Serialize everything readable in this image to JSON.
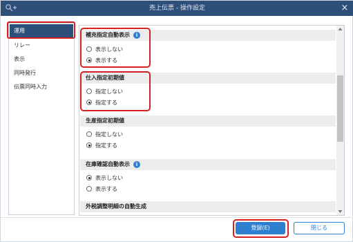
{
  "window": {
    "title": "売上伝票 - 操作設定",
    "close_glyph": "×",
    "icons": {
      "app": "app-key-plus-icon",
      "close": "close-icon",
      "info": "info-icon"
    }
  },
  "sidebar": {
    "items": [
      {
        "label": "運用",
        "active": true
      },
      {
        "label": "リレー",
        "active": false
      },
      {
        "label": "表示",
        "active": false
      },
      {
        "label": "同時発行",
        "active": false
      },
      {
        "label": "伝票同時入力",
        "active": false
      }
    ]
  },
  "sections": [
    {
      "title": "補充指定自動表示",
      "has_info": true,
      "options": [
        {
          "label": "表示しない",
          "checked": false
        },
        {
          "label": "表示する",
          "checked": true
        }
      ]
    },
    {
      "title": "仕入指定初期値",
      "has_info": false,
      "options": [
        {
          "label": "指定しない",
          "checked": false
        },
        {
          "label": "指定する",
          "checked": true
        }
      ]
    },
    {
      "title": "生産指定初期値",
      "has_info": false,
      "options": [
        {
          "label": "指定しない",
          "checked": false
        },
        {
          "label": "指定する",
          "checked": true
        }
      ]
    },
    {
      "title": "在庫確認自動表示",
      "has_info": true,
      "options": [
        {
          "label": "表示しない",
          "checked": true
        },
        {
          "label": "表示する",
          "checked": false
        }
      ]
    },
    {
      "title": "外税調整明細の自動生成",
      "has_info": false,
      "options": []
    }
  ],
  "footer": {
    "register_label": "登録(E)",
    "close_label": "閉じる"
  },
  "colors": {
    "titlebar": "#2f4f7b",
    "accent": "#2e7fd0",
    "highlight": "#d62020"
  }
}
